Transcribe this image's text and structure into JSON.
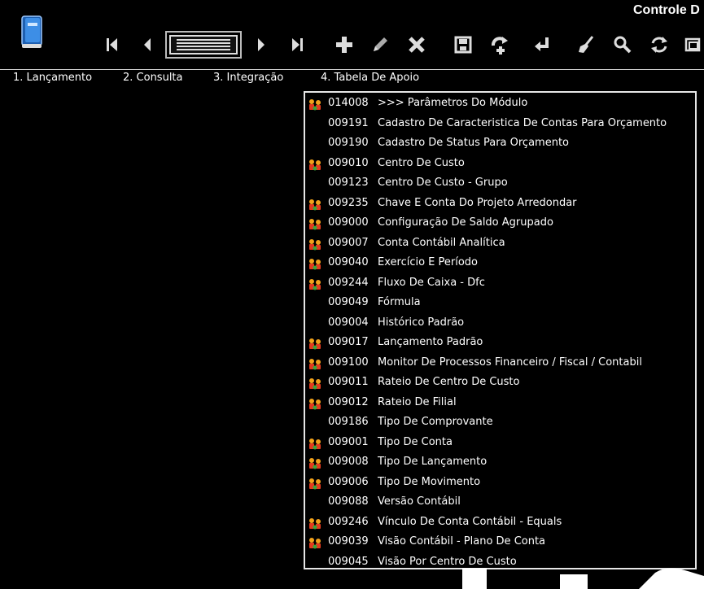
{
  "app": {
    "title": "Controle D"
  },
  "toolbar": {
    "buttons": [
      {
        "icon": "first-record-icon"
      },
      {
        "icon": "previous-record-icon"
      },
      {
        "icon": "record-list-icon"
      },
      {
        "icon": "next-record-icon"
      },
      {
        "icon": "last-record-icon"
      },
      {
        "icon": "add-icon"
      },
      {
        "icon": "edit-pencil-icon"
      },
      {
        "icon": "delete-x-icon"
      },
      {
        "icon": "save-disk-icon"
      },
      {
        "icon": "copy-add-icon"
      },
      {
        "icon": "return-arrow-icon"
      },
      {
        "icon": "clear-broom-icon"
      },
      {
        "icon": "search-icon"
      },
      {
        "icon": "refresh-icon"
      },
      {
        "icon": "window-icon"
      }
    ]
  },
  "menu": {
    "items": [
      {
        "label": "1. Lançamento"
      },
      {
        "label": "2. Consulta"
      },
      {
        "label": "3. Integração"
      },
      {
        "label": "4. Tabela De Apoio"
      }
    ]
  },
  "dropdown": {
    "items": [
      {
        "code": "014008",
        "label": ">>> Parâmetros Do Módulo",
        "has_icon": true
      },
      {
        "code": "009191",
        "label": "Cadastro De Caracteristica De Contas Para Orçamento",
        "has_icon": false
      },
      {
        "code": "009190",
        "label": "Cadastro De Status Para Orçamento",
        "has_icon": false
      },
      {
        "code": "009010",
        "label": "Centro De Custo",
        "has_icon": true
      },
      {
        "code": "009123",
        "label": "Centro De Custo - Grupo",
        "has_icon": false
      },
      {
        "code": "009235",
        "label": "Chave E Conta Do Projeto Arredondar",
        "has_icon": true
      },
      {
        "code": "009000",
        "label": "Configuração De Saldo Agrupado",
        "has_icon": true
      },
      {
        "code": "009007",
        "label": "Conta Contábil Analítica",
        "has_icon": true
      },
      {
        "code": "009040",
        "label": "Exercício E Período",
        "has_icon": true
      },
      {
        "code": "009244",
        "label": "Fluxo De Caixa - Dfc",
        "has_icon": true
      },
      {
        "code": "009049",
        "label": "Fórmula",
        "has_icon": false
      },
      {
        "code": "009004",
        "label": "Histórico Padrão",
        "has_icon": false
      },
      {
        "code": "009017",
        "label": "Lançamento Padrão",
        "has_icon": true
      },
      {
        "code": "009100",
        "label": "Monitor De Processos Financeiro / Fiscal / Contabil",
        "has_icon": true
      },
      {
        "code": "009011",
        "label": "Rateio De Centro De Custo",
        "has_icon": true
      },
      {
        "code": "009012",
        "label": "Rateio De Filial",
        "has_icon": true
      },
      {
        "code": "009186",
        "label": "Tipo De Comprovante",
        "has_icon": false
      },
      {
        "code": "009001",
        "label": "Tipo De Conta",
        "has_icon": true
      },
      {
        "code": "009008",
        "label": "Tipo De Lançamento",
        "has_icon": true
      },
      {
        "code": "009006",
        "label": "Tipo De Movimento",
        "has_icon": true
      },
      {
        "code": "009088",
        "label": "Versão Contábil",
        "has_icon": false
      },
      {
        "code": "009246",
        "label": "Vínculo De Conta Contábil - Equals",
        "has_icon": true
      },
      {
        "code": "009039",
        "label": "Visão Contábil - Plano De Conta",
        "has_icon": true
      },
      {
        "code": "009045",
        "label": "Visão Por Centro De Custo",
        "has_icon": false
      }
    ]
  },
  "colors": {
    "background": "#000000",
    "text": "#ffffff",
    "logo_blue": "#2f7fd6",
    "row_icon_red": "#e23a1e",
    "row_icon_orange": "#f2a21c",
    "row_icon_green": "#3aa53a"
  }
}
